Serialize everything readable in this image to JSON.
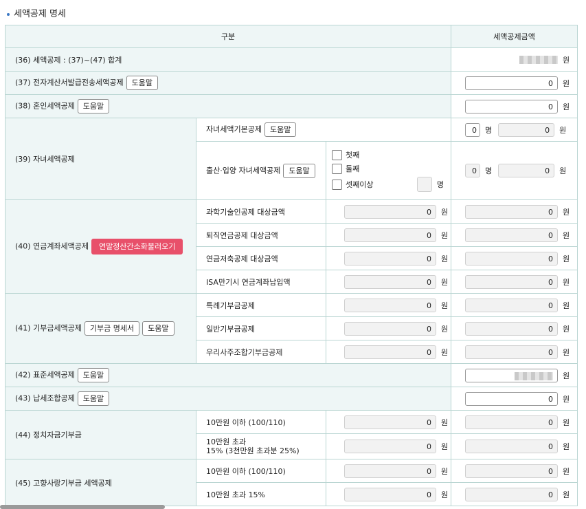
{
  "title": "세액공제 명세",
  "header": {
    "col1": "구분",
    "col2": "세액공제금액"
  },
  "btn_help": "도움말",
  "unit_won": "원",
  "unit_person": "명",
  "zero": "0",
  "rows": {
    "r36": "(36) 세액공제 : (37)~(47) 합계",
    "r37": "(37) 전자계산서발급전송세액공제",
    "r38": "(38) 혼인세액공제",
    "r39": "(39) 자녀세액공제",
    "r39a": "자녀세액기본공제",
    "r39b": "출산·입양 자녀세액공제",
    "r39b_opts": [
      "첫째",
      "둘째",
      "셋째이상"
    ],
    "r40": "(40) 연금계좌세액공제",
    "r40_btn": "연말정산간소화불러오기",
    "r40_subs": [
      "과학기술인공제 대상금액",
      "퇴직연금공제 대상금액",
      "연금저축공제 대상금액",
      "ISA만기시 연금계좌납입액"
    ],
    "r41": "(41) 기부금세액공제",
    "r41_btn": "기부금 명세서",
    "r41_subs": [
      "특례기부금공제",
      "일반기부금공제",
      "우리사주조합기부금공제"
    ],
    "r42": "(42) 표준세액공제",
    "r43": "(43) 납세조합공제",
    "r44": "(44) 정치자금기부금",
    "r44_subs": [
      "10만원 이하 (100/110)",
      "10만원 초과",
      "15% (3천만원 초과분 25%)"
    ],
    "r45": "(45) 고향사랑기부금 세액공제",
    "r45_subs": [
      "10만원 이하 (100/110)",
      "10만원 초과 15%"
    ]
  }
}
